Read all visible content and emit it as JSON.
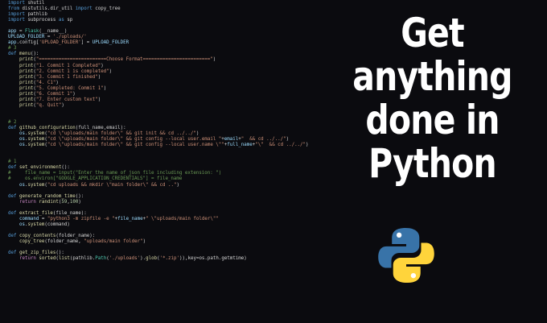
{
  "editor": {
    "lines": [
      [
        [
          "kw",
          "import"
        ],
        [
          "op",
          " shutil"
        ]
      ],
      [
        [
          "kw",
          "from"
        ],
        [
          "op",
          " distutils.dir_util "
        ],
        [
          "kw",
          "import"
        ],
        [
          "op",
          " copy_tree"
        ]
      ],
      [
        [
          "kw",
          "import"
        ],
        [
          "op",
          " pathlib"
        ]
      ],
      [
        [
          "kw",
          "import"
        ],
        [
          "op",
          " subprocess "
        ],
        [
          "kw",
          "as"
        ],
        [
          "op",
          " sp"
        ]
      ],
      [],
      [
        [
          "var",
          "app"
        ],
        [
          "op",
          " = "
        ],
        [
          "mod",
          "Flask"
        ],
        [
          "op",
          "(__name__)"
        ]
      ],
      [
        [
          "var",
          "UPLOAD_FOLDER"
        ],
        [
          "op",
          " = "
        ],
        [
          "str",
          "'./uploads/'"
        ]
      ],
      [
        [
          "var",
          "app"
        ],
        [
          "op",
          ".config["
        ],
        [
          "str",
          "'UPLOAD_FOLDER'"
        ],
        [
          "op",
          "] = "
        ],
        [
          "var",
          "UPLOAD_FOLDER"
        ]
      ],
      [
        [
          "cm",
          "# 3"
        ]
      ],
      [
        [
          "kw",
          "def"
        ],
        [
          "op",
          " "
        ],
        [
          "fn",
          "menu"
        ],
        [
          "op",
          "():"
        ]
      ],
      [
        [
          "op",
          "    "
        ],
        [
          "fn",
          "print"
        ],
        [
          "op",
          "("
        ],
        [
          "str",
          "\"========================Choose Format========================\""
        ],
        [
          "op",
          ")"
        ]
      ],
      [
        [
          "op",
          "    "
        ],
        [
          "fn",
          "print"
        ],
        [
          "op",
          "("
        ],
        [
          "str",
          "\"1. Commit 1 Completed\""
        ],
        [
          "op",
          ")"
        ]
      ],
      [
        [
          "op",
          "    "
        ],
        [
          "fn",
          "print"
        ],
        [
          "op",
          "("
        ],
        [
          "str",
          "\"2. Commit 1 is completed\""
        ],
        [
          "op",
          ")"
        ]
      ],
      [
        [
          "op",
          "    "
        ],
        [
          "fn",
          "print"
        ],
        [
          "op",
          "("
        ],
        [
          "str",
          "\"3. Commit 1 finished\""
        ],
        [
          "op",
          ")"
        ]
      ],
      [
        [
          "op",
          "    "
        ],
        [
          "fn",
          "print"
        ],
        [
          "op",
          "("
        ],
        [
          "str",
          "\"4. C1\""
        ],
        [
          "op",
          ")"
        ]
      ],
      [
        [
          "op",
          "    "
        ],
        [
          "fn",
          "print"
        ],
        [
          "op",
          "("
        ],
        [
          "str",
          "\"5. Completed: Commit 1\""
        ],
        [
          "op",
          ")"
        ]
      ],
      [
        [
          "op",
          "    "
        ],
        [
          "fn",
          "print"
        ],
        [
          "op",
          "("
        ],
        [
          "str",
          "\"6. Commit 1\""
        ],
        [
          "op",
          ")"
        ]
      ],
      [
        [
          "op",
          "    "
        ],
        [
          "fn",
          "print"
        ],
        [
          "op",
          "("
        ],
        [
          "str",
          "\"7. Enter custom text\""
        ],
        [
          "op",
          ")"
        ]
      ],
      [
        [
          "op",
          "    "
        ],
        [
          "fn",
          "print"
        ],
        [
          "op",
          "("
        ],
        [
          "str",
          "\"q. Quit\""
        ],
        [
          "op",
          ")"
        ]
      ],
      [],
      [],
      [
        [
          "cm",
          "# 2"
        ]
      ],
      [
        [
          "kw",
          "def"
        ],
        [
          "op",
          " "
        ],
        [
          "fn",
          "github_configuration"
        ],
        [
          "op",
          "(full_name,email):"
        ]
      ],
      [
        [
          "op",
          "    "
        ],
        [
          "var",
          "os"
        ],
        [
          "op",
          "."
        ],
        [
          "fn",
          "system"
        ],
        [
          "op",
          "("
        ],
        [
          "str",
          "\"cd \\\"uploads/main folder\\\" && git init && cd ../../\""
        ],
        [
          "op",
          ")"
        ]
      ],
      [
        [
          "op",
          "    "
        ],
        [
          "var",
          "os"
        ],
        [
          "op",
          "."
        ],
        [
          "fn",
          "system"
        ],
        [
          "op",
          "("
        ],
        [
          "str",
          "\"cd \\\"uploads/main folder\\\" && git config --local user.email \""
        ],
        [
          "op",
          "+"
        ],
        [
          "var",
          "email"
        ],
        [
          "op",
          "+"
        ],
        [
          "str",
          "\"  && cd ../../\""
        ],
        [
          "op",
          ")"
        ]
      ],
      [
        [
          "op",
          "    "
        ],
        [
          "var",
          "os"
        ],
        [
          "op",
          "."
        ],
        [
          "fn",
          "system"
        ],
        [
          "op",
          "("
        ],
        [
          "str",
          "\"cd \\\"uploads/main folder\\\" && git config --local user.name \\\"\""
        ],
        [
          "op",
          "+"
        ],
        [
          "var",
          "full_name"
        ],
        [
          "op",
          "+"
        ],
        [
          "str",
          "\"\\\"  && cd ../../\""
        ],
        [
          "op",
          ")"
        ]
      ],
      [],
      [],
      [
        [
          "cm",
          "# 1"
        ]
      ],
      [
        [
          "kw",
          "def"
        ],
        [
          "op",
          " "
        ],
        [
          "fn",
          "set_environment"
        ],
        [
          "op",
          "():"
        ]
      ],
      [
        [
          "cm",
          "#     file_name = input(\"Enter the name of json file including extension: \")"
        ]
      ],
      [
        [
          "cm",
          "#     os.environ[\"GOOGLE_APPLICATION_CREDENTIALS\"] = file_name"
        ]
      ],
      [
        [
          "op",
          "    "
        ],
        [
          "var",
          "os"
        ],
        [
          "op",
          "."
        ],
        [
          "fn",
          "system"
        ],
        [
          "op",
          "("
        ],
        [
          "str",
          "\"cd uploads && mkdir \\\"main folder\\\" && cd ..\""
        ],
        [
          "op",
          ")"
        ]
      ],
      [],
      [
        [
          "kw",
          "def"
        ],
        [
          "op",
          " "
        ],
        [
          "fn",
          "generate_random_time"
        ],
        [
          "op",
          "():"
        ]
      ],
      [
        [
          "op",
          "    "
        ],
        [
          "ctrl",
          "return"
        ],
        [
          "op",
          " "
        ],
        [
          "fn",
          "randint"
        ],
        [
          "op",
          "("
        ],
        [
          "num",
          "59"
        ],
        [
          "op",
          ","
        ],
        [
          "num",
          "100"
        ],
        [
          "op",
          ")"
        ]
      ],
      [],
      [
        [
          "kw",
          "def"
        ],
        [
          "op",
          " "
        ],
        [
          "fn",
          "extract_file"
        ],
        [
          "op",
          "(file_name):"
        ]
      ],
      [
        [
          "op",
          "    "
        ],
        [
          "var",
          "command"
        ],
        [
          "op",
          " = "
        ],
        [
          "str",
          "\"python3 -m zipfile -e \""
        ],
        [
          "op",
          "+"
        ],
        [
          "var",
          "file_name"
        ],
        [
          "op",
          "+"
        ],
        [
          "str",
          "\" \\\"uploads/main folder\\\"\""
        ]
      ],
      [
        [
          "op",
          "    "
        ],
        [
          "var",
          "os"
        ],
        [
          "op",
          "."
        ],
        [
          "fn",
          "system"
        ],
        [
          "op",
          "(command)"
        ]
      ],
      [],
      [
        [
          "kw",
          "def"
        ],
        [
          "op",
          " "
        ],
        [
          "fn",
          "copy_contents"
        ],
        [
          "op",
          "(folder_name):"
        ]
      ],
      [
        [
          "op",
          "    "
        ],
        [
          "fn",
          "copy_tree"
        ],
        [
          "op",
          "(folder_name, "
        ],
        [
          "str",
          "\"uploads/main folder\""
        ],
        [
          "op",
          ")"
        ]
      ],
      [],
      [
        [
          "kw",
          "def"
        ],
        [
          "op",
          " "
        ],
        [
          "fn",
          "get_zip_files"
        ],
        [
          "op",
          "():"
        ]
      ],
      [
        [
          "op",
          "    "
        ],
        [
          "ctrl",
          "return"
        ],
        [
          "op",
          " "
        ],
        [
          "fn",
          "sorted"
        ],
        [
          "op",
          "("
        ],
        [
          "fn",
          "list"
        ],
        [
          "op",
          "(pathlib."
        ],
        [
          "mod",
          "Path"
        ],
        [
          "op",
          "("
        ],
        [
          "str",
          "'./uploads'"
        ],
        [
          "op",
          ")."
        ],
        [
          "fn",
          "glob"
        ],
        [
          "op",
          "("
        ],
        [
          "str",
          "'*.zip'"
        ],
        [
          "op",
          ")),key=os.path.getmtime)"
        ]
      ]
    ]
  },
  "headline": {
    "lines": [
      "Get",
      "anything",
      "done in",
      "Python"
    ]
  },
  "logo": {
    "icon": "python-logo-icon",
    "colors": {
      "blue": "#3873a8",
      "yellow": "#ffd43b"
    }
  }
}
